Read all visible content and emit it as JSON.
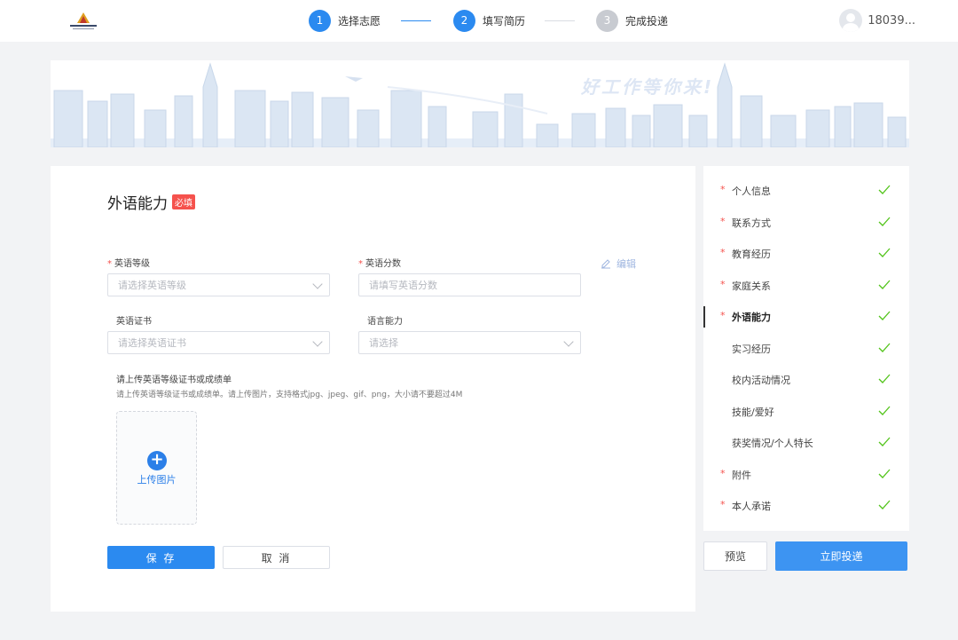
{
  "header": {
    "steps": [
      {
        "num": "1",
        "label": "选择志愿",
        "state": "done"
      },
      {
        "num": "2",
        "label": "填写简历",
        "state": "current"
      },
      {
        "num": "3",
        "label": "完成投递",
        "state": "pending"
      }
    ],
    "user_name": "18039..."
  },
  "banner": {
    "slogan": "好工作等你来!"
  },
  "section": {
    "title": "外语能力",
    "required_badge": "必填"
  },
  "form": {
    "english_level": {
      "label": "英语等级",
      "placeholder": "请选择英语等级"
    },
    "english_score": {
      "label": "英语分数",
      "placeholder": "请填写英语分数"
    },
    "edit_label": "编辑",
    "english_cert": {
      "label": "英语证书",
      "placeholder": "请选择英语证书"
    },
    "language_ability": {
      "label": "语言能力",
      "placeholder": "请选择"
    },
    "upload_title": "请上传英语等级证书或成绩单",
    "upload_hint": "请上传英语等级证书或成绩单。请上传图片，支持格式jpg、jpeg、gif、png，大小请不要超过4M",
    "upload_label": "上传图片",
    "save_label": "保 存",
    "cancel_label": "取 消"
  },
  "sidebar": {
    "items": [
      {
        "label": "个人信息",
        "required": true
      },
      {
        "label": "联系方式",
        "required": true
      },
      {
        "label": "教育经历",
        "required": true
      },
      {
        "label": "家庭关系",
        "required": true
      },
      {
        "label": "外语能力",
        "required": true,
        "active": true
      },
      {
        "label": "实习经历",
        "required": false
      },
      {
        "label": "校内活动情况",
        "required": false
      },
      {
        "label": "技能/爱好",
        "required": false
      },
      {
        "label": "获奖情况/个人特长",
        "required": false
      },
      {
        "label": "附件",
        "required": true
      },
      {
        "label": "本人承诺",
        "required": true
      }
    ],
    "preview_label": "预览",
    "submit_label": "立即投递"
  },
  "colors": {
    "primary": "#2b8af0",
    "required": "#f5524d",
    "check": "#52c41a"
  }
}
